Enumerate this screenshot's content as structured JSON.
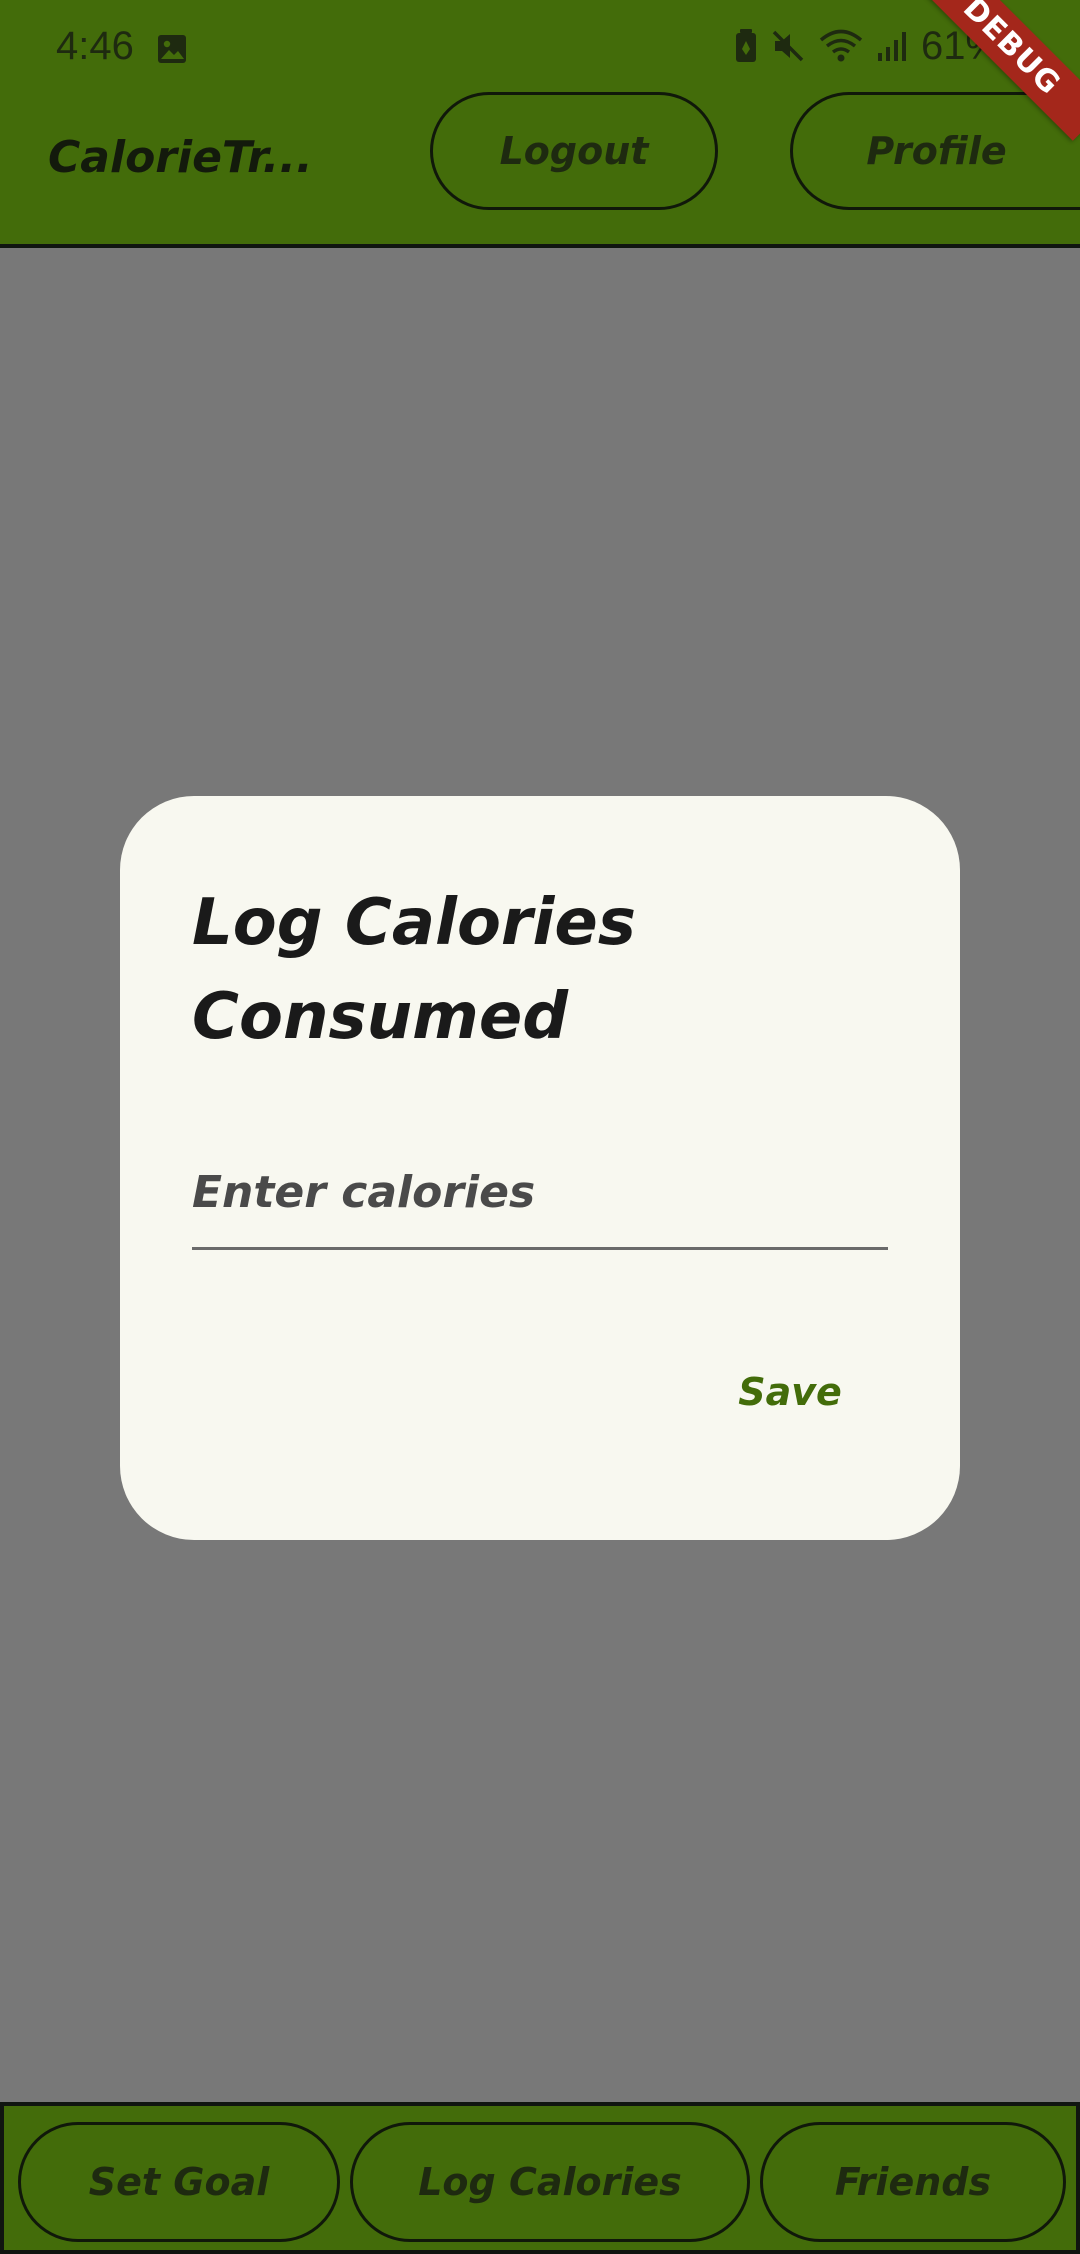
{
  "status_bar": {
    "time": "4:46",
    "battery": "61%",
    "icons": [
      "gallery-icon",
      "battery-saver-icon",
      "mute-icon",
      "wifi-icon",
      "signal-icon",
      "battery-icon"
    ]
  },
  "app_bar": {
    "title": "CalorieTr...",
    "logout_label": "Logout",
    "profile_label": "Profile",
    "debug_label": "DEBUG"
  },
  "dialog": {
    "title": "Log Calories Consumed",
    "input": {
      "placeholder": "Enter calories",
      "value": ""
    },
    "save_label": "Save"
  },
  "bottom_nav": {
    "items": [
      {
        "label": "Set Goal"
      },
      {
        "label": "Log Calories"
      },
      {
        "label": "Friends"
      }
    ]
  },
  "colors": {
    "brand_green": "#436c0a",
    "scrim": "#787878",
    "dialog_bg": "#f8f8f0",
    "debug_red": "#a4271b"
  }
}
